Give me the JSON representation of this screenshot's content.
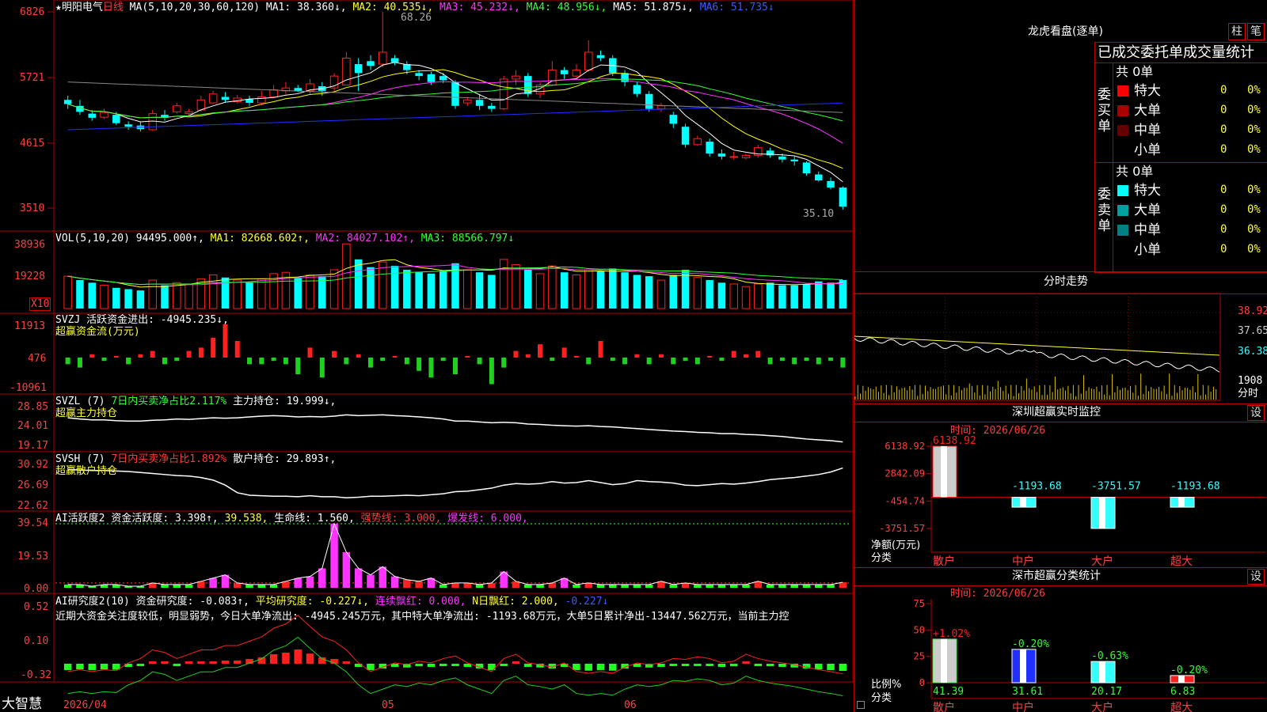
{
  "app": {
    "brand": "大智慧",
    "stock_name": "★明阳电气",
    "period": "日线"
  },
  "colors": {
    "up": "#ff2020",
    "down": "#00ffff",
    "grid": "#b00000",
    "ma1": "#ffffff",
    "ma2": "#ffff00",
    "ma3": "#ff33ff",
    "ma4": "#33ff33",
    "ma5": "#888888",
    "ma6": "#2030ff"
  },
  "price_panel": {
    "ma_header": "MA(5,10,20,30,60,120)",
    "ma1": "MA1: 38.360↓,",
    "ma2": "MA2: 40.535↓,",
    "ma3": "MA3: 45.232↓,",
    "ma4": "MA4: 48.956↓,",
    "ma5": "MA5: 51.875↓,",
    "ma6": "MA6: 51.735↓",
    "y_ticks": [
      "6826",
      "5721",
      "4615",
      "3510"
    ],
    "high_label": "68.26",
    "low_label": "35.10"
  },
  "volume_panel": {
    "header": "VOL(5,10,20)",
    "value": "94495.000↑,",
    "ma1": "MA1: 82668.602↑,",
    "ma2": "MA2: 84027.102↑,",
    "ma3": "MA3: 88566.797↓",
    "y_ticks": [
      "38936",
      "19228"
    ],
    "unit": "X10"
  },
  "svzj_panel": {
    "name": "SVZJ",
    "label": "活跃资金进出: -4945.235↓,",
    "sub": "超赢资金流(万元)",
    "y_ticks": [
      "11913",
      "476",
      "-10961"
    ]
  },
  "svzl_panel": {
    "name": "SVZL (7)",
    "label1": "7日内买卖净占比2.117%",
    "label2": "主力持仓: 19.999↓,",
    "sub": "超赢主力持仓",
    "y_ticks": [
      "28.85",
      "24.01",
      "19.17"
    ]
  },
  "svsh_panel": {
    "name": "SVSH (7)",
    "label1": "7日内买卖净占比1.892%",
    "label2": "散户持仓: 29.893↑,",
    "sub": "超赢散户持仓",
    "y_ticks": [
      "30.92",
      "26.69",
      "22.62"
    ]
  },
  "ai_active_panel": {
    "name": "AI活跃度2",
    "label1": "资金活跃度: 3.398↑,",
    "label2": "39.538,",
    "label3": "生命线: 1.560,",
    "label4": "强势线: 3.000,",
    "label5": "爆发线: 6.000,",
    "y_ticks": [
      "39.54",
      "19.53",
      "0.00"
    ]
  },
  "ai_research_panel": {
    "name": "AI研究度2(10)",
    "label1": "资金研究度: -0.083↑,",
    "label2": "平均研究度: -0.227↓,",
    "label3": "连续飘红: 0.000,",
    "label4": "N日飘红: 2.000,",
    "label5": "-0.227↓",
    "comment": "近期大资金关注度较低，明显弱势，今日大单净流出: -4945.245万元，其中特大单净流出: -1193.68万元，大单5日累计净出-13447.562万元，当前主力控",
    "y_ticks": [
      "0.52",
      "0.10",
      "-0.32"
    ]
  },
  "date_axis": [
    "2026/04",
    "05",
    "06"
  ],
  "right_panel": {
    "dragon_title": "龙虎看盘(逐单)",
    "tab_bar": "柱",
    "tab_pen": "笔",
    "stats_title": "已成交委托单成交量统计",
    "buy_side": {
      "label": "委买单",
      "total": "共 0单",
      "rows": [
        {
          "name": "特大",
          "count": "0",
          "pct": "0%",
          "color": "#ff0000"
        },
        {
          "name": "大单",
          "count": "0",
          "pct": "0%",
          "color": "#aa0000"
        },
        {
          "name": "中单",
          "count": "0",
          "pct": "0%",
          "color": "#660000"
        },
        {
          "name": "小单",
          "count": "0",
          "pct": "0%",
          "color": ""
        }
      ]
    },
    "sell_side": {
      "label": "委卖单",
      "total": "共 0单",
      "rows": [
        {
          "name": "特大",
          "count": "0",
          "pct": "0%",
          "color": "#00ffff"
        },
        {
          "name": "大单",
          "count": "0",
          "pct": "0%",
          "color": "#00a0a0"
        },
        {
          "name": "中单",
          "count": "0",
          "pct": "0%",
          "color": "#008080"
        },
        {
          "name": "小单",
          "count": "0",
          "pct": "0%",
          "color": ""
        }
      ]
    },
    "intraday": {
      "title": "分时走势",
      "y_ticks": [
        "38.92",
        "37.65",
        "36.38"
      ],
      "vol_label": "1908",
      "unit": "分时"
    },
    "monitor": {
      "title": "深圳超赢实时监控",
      "set": "设",
      "time": "时间: 2026/06/26",
      "y_ticks": [
        "6138.92",
        "2842.09",
        "-454.74",
        "-3751.57"
      ],
      "ylabel": "净额(万元)",
      "xlabel": "分类",
      "categories": [
        "散户",
        "中户",
        "大户",
        "超大"
      ],
      "values": [
        6138.92,
        -1193.68,
        -3751.57,
        -1193.68
      ],
      "value_labels": [
        "6138.92",
        "-1193.68",
        "-3751.57",
        "-1193.68"
      ]
    },
    "classify": {
      "title": "深市超赢分类统计",
      "set": "设",
      "time": "时间: 2026/06/26",
      "y_ticks": [
        "75",
        "50",
        "25",
        "0"
      ],
      "ylabel": "比例%",
      "xlabel": "分类",
      "categories": [
        "散户",
        "中户",
        "大户",
        "超大"
      ],
      "values": [
        41.39,
        31.61,
        20.17,
        6.83
      ],
      "value_labels": [
        "41.39",
        "31.61",
        "20.17",
        "6.83"
      ],
      "changes": [
        "+1.02%",
        "-0.20%",
        "-0.63%",
        "-0.20%"
      ]
    }
  },
  "chart_data": {
    "type": "candlestick",
    "title": "★明阳电气 日线",
    "ylim": [
      35.1,
      68.26
    ],
    "candles": [
      [
        53.5,
        52.8,
        54.2,
        52.0
      ],
      [
        52.5,
        51.5,
        53.5,
        51.0
      ],
      [
        51.2,
        50.5,
        51.8,
        50.0
      ],
      [
        50.6,
        51.4,
        52.0,
        50.3
      ],
      [
        51.0,
        49.6,
        51.5,
        49.3
      ],
      [
        49.4,
        49.0,
        49.9,
        48.5
      ],
      [
        49.2,
        48.6,
        49.8,
        48.2
      ],
      [
        48.5,
        51.2,
        51.8,
        48.3
      ],
      [
        51.0,
        50.5,
        51.8,
        50.0
      ],
      [
        51.5,
        52.5,
        53.0,
        51.2
      ],
      [
        51.2,
        51.5,
        52.0,
        50.8
      ],
      [
        51.8,
        53.5,
        54.2,
        51.5
      ],
      [
        53.0,
        54.5,
        55.0,
        52.8
      ],
      [
        54.0,
        53.5,
        54.8,
        53.0
      ],
      [
        53.2,
        53.8,
        54.3,
        52.9
      ],
      [
        53.6,
        53.0,
        54.2,
        52.5
      ],
      [
        53.0,
        54.0,
        55.0,
        52.6
      ],
      [
        54.0,
        55.2,
        56.0,
        53.8
      ],
      [
        55.0,
        55.5,
        56.5,
        54.5
      ],
      [
        55.5,
        55.0,
        56.0,
        54.8
      ],
      [
        55.0,
        56.2,
        57.0,
        54.5
      ],
      [
        55.8,
        55.0,
        56.5,
        54.2
      ],
      [
        55.5,
        57.5,
        58.0,
        55.0
      ],
      [
        56.0,
        60.5,
        61.5,
        56.0
      ],
      [
        59.5,
        58.0,
        60.5,
        55.0
      ],
      [
        60.0,
        59.2,
        61.0,
        58.5
      ],
      [
        59.5,
        61.5,
        68.26,
        59.0
      ],
      [
        60.5,
        59.8,
        61.0,
        59.3
      ],
      [
        59.5,
        58.5,
        60.0,
        57.8
      ],
      [
        58.0,
        57.5,
        58.5,
        56.8
      ],
      [
        57.8,
        56.5,
        58.2,
        56.0
      ],
      [
        57.5,
        56.8,
        58.0,
        56.3
      ],
      [
        56.5,
        52.5,
        56.8,
        52.0
      ],
      [
        53.0,
        53.5,
        54.0,
        52.5
      ],
      [
        53.5,
        52.5,
        54.5,
        51.8
      ],
      [
        52.5,
        52.0,
        53.0,
        51.5
      ],
      [
        52.0,
        57.0,
        57.5,
        51.8
      ],
      [
        57.0,
        57.5,
        58.5,
        56.0
      ],
      [
        57.5,
        54.5,
        58.0,
        54.0
      ],
      [
        54.5,
        56.0,
        56.5,
        53.8
      ],
      [
        56.0,
        58.5,
        60.0,
        55.8
      ],
      [
        58.5,
        57.8,
        59.0,
        57.0
      ],
      [
        57.5,
        58.5,
        59.5,
        57.2
      ],
      [
        58.5,
        61.5,
        63.5,
        58.2
      ],
      [
        61.0,
        60.5,
        61.8,
        60.0
      ],
      [
        60.5,
        58.0,
        61.0,
        57.5
      ],
      [
        58.0,
        56.5,
        58.5,
        55.8
      ],
      [
        56.0,
        54.5,
        56.5,
        54.0
      ],
      [
        54.5,
        52.0,
        55.0,
        51.5
      ],
      [
        52.0,
        52.5,
        53.0,
        51.5
      ],
      [
        51.0,
        49.5,
        51.5,
        48.8
      ],
      [
        49.0,
        46.0,
        49.5,
        45.5
      ],
      [
        46.0,
        47.0,
        47.5,
        45.8
      ],
      [
        46.5,
        44.5,
        47.0,
        44.0
      ],
      [
        44.5,
        44.0,
        45.2,
        43.5
      ],
      [
        44.0,
        44.0,
        44.8,
        43.5
      ],
      [
        43.8,
        44.2,
        44.5,
        43.5
      ],
      [
        44.2,
        45.5,
        46.0,
        43.8
      ],
      [
        45.0,
        44.2,
        45.5,
        43.8
      ],
      [
        44.0,
        43.5,
        44.5,
        43.0
      ],
      [
        43.5,
        43.2,
        44.0,
        42.5
      ],
      [
        43.0,
        41.2,
        43.2,
        40.8
      ],
      [
        41.0,
        40.0,
        41.5,
        39.8
      ],
      [
        39.9,
        38.8,
        40.5,
        38.5
      ],
      [
        38.8,
        35.6,
        39.0,
        35.1
      ]
    ],
    "volume": [
      25,
      22,
      20,
      18,
      16,
      15,
      14,
      22,
      18,
      20,
      19,
      23,
      26,
      24,
      22,
      20,
      23,
      27,
      28,
      24,
      26,
      25,
      30,
      50,
      38,
      32,
      36,
      33,
      30,
      28,
      27,
      29,
      35,
      30,
      28,
      26,
      38,
      34,
      30,
      27,
      33,
      28,
      26,
      30,
      29,
      31,
      28,
      26,
      25,
      22,
      26,
      30,
      24,
      22,
      20,
      19,
      17,
      19,
      20,
      18,
      18,
      19,
      21,
      20,
      22
    ],
    "volume_up": [
      1,
      0,
      0,
      1,
      0,
      0,
      0,
      1,
      0,
      1,
      1,
      1,
      1,
      0,
      1,
      0,
      1,
      1,
      1,
      0,
      1,
      0,
      1,
      1,
      0,
      0,
      1,
      0,
      0,
      0,
      0,
      0,
      0,
      1,
      0,
      0,
      1,
      1,
      0,
      1,
      1,
      0,
      1,
      1,
      0,
      0,
      0,
      0,
      0,
      1,
      0,
      0,
      1,
      0,
      0,
      1,
      1,
      1,
      0,
      0,
      0,
      0,
      0,
      0,
      0
    ],
    "fund_flow": [
      -2,
      -3,
      1,
      -1,
      0,
      -2,
      1,
      2,
      -2,
      -1,
      2,
      3,
      6,
      10,
      5,
      -2,
      -2,
      -1,
      -2,
      -5,
      3,
      -6,
      2,
      -2,
      1,
      -3,
      -1,
      0,
      -2,
      -4,
      -6,
      -1,
      -5,
      0,
      -2,
      -8,
      -3,
      2,
      1,
      4,
      -1,
      3,
      0,
      -2,
      5,
      -1,
      -2,
      1,
      -2,
      1,
      -2,
      -1,
      -2,
      0,
      -1,
      2,
      1,
      2,
      -2,
      -1,
      -2,
      -1,
      -2,
      -1,
      -3
    ],
    "main_position": [
      25.8,
      25.5,
      25.3,
      25.3,
      25.1,
      25.0,
      25.0,
      25.2,
      25.3,
      25.5,
      25.4,
      25.6,
      25.8,
      25.7,
      25.8,
      26.0,
      26.2,
      26.3,
      26.2,
      26.0,
      26.1,
      26.0,
      26.2,
      26.5,
      26.3,
      26.4,
      26.5,
      26.3,
      26.2,
      26.0,
      25.8,
      25.5,
      25.0,
      25.0,
      24.8,
      24.6,
      24.7,
      24.6,
      24.3,
      24.2,
      24.0,
      23.9,
      23.8,
      23.9,
      23.7,
      23.6,
      23.4,
      23.2,
      23.0,
      22.8,
      22.6,
      22.5,
      22.3,
      22.2,
      22.0,
      22.0,
      21.8,
      21.7,
      21.5,
      21.3,
      21.0,
      20.7,
      20.5,
      20.3,
      19.999
    ],
    "retail_position": [
      29.6,
      29.5,
      29.4,
      29.4,
      29.3,
      29.2,
      29.0,
      28.8,
      28.6,
      28.4,
      28.3,
      28.0,
      27.5,
      26.5,
      25.0,
      24.5,
      24.4,
      24.3,
      24.3,
      24.2,
      24.4,
      24.2,
      24.2,
      24.0,
      24.1,
      24.3,
      24.3,
      24.4,
      24.5,
      24.4,
      24.6,
      24.8,
      25.2,
      25.3,
      25.6,
      25.9,
      26.5,
      26.8,
      26.7,
      26.8,
      27.2,
      26.9,
      27.0,
      27.4,
      27.0,
      26.6,
      26.8,
      27.4,
      27.2,
      27.1,
      26.9,
      26.5,
      26.4,
      26.6,
      26.8,
      26.7,
      26.9,
      27.2,
      27.6,
      27.8,
      28.0,
      28.3,
      28.6,
      29.1,
      29.893
    ],
    "ai_active": [
      2,
      2,
      1,
      2,
      2,
      1,
      1,
      3,
      2,
      2,
      2,
      4,
      6,
      8,
      3,
      2,
      2,
      2,
      4,
      6,
      7,
      12,
      39.5,
      22,
      12,
      8,
      13,
      7,
      5,
      4,
      6,
      2,
      3,
      3,
      2,
      3,
      10,
      4,
      2,
      2,
      3,
      6,
      2,
      3,
      2,
      2,
      2,
      2,
      2,
      4,
      2,
      3,
      2,
      2,
      2,
      2,
      2,
      4,
      2,
      2,
      2,
      2,
      2,
      2,
      3.4
    ],
    "ai_research": [
      -0.2,
      -0.18,
      -0.2,
      -0.18,
      -0.19,
      -0.1,
      -0.05,
      0.05,
      0.02,
      -0.05,
      0.0,
      0.05,
      0.05,
      0.1,
      0.1,
      0.15,
      0.2,
      0.3,
      0.35,
      0.45,
      0.32,
      0.2,
      0.15,
      0.05,
      -0.1,
      -0.2,
      -0.15,
      -0.1,
      -0.12,
      -0.08,
      -0.1,
      -0.05,
      -0.02,
      -0.1,
      -0.15,
      -0.2,
      -0.05,
      0.0,
      -0.1,
      -0.12,
      -0.15,
      -0.1,
      -0.2,
      -0.22,
      -0.2,
      -0.22,
      -0.15,
      -0.1,
      -0.12,
      -0.1,
      -0.05,
      -0.06,
      -0.03,
      -0.05,
      -0.1,
      -0.08,
      0.0,
      -0.05,
      -0.08,
      -0.1,
      -0.12,
      -0.15,
      -0.18,
      -0.2,
      -0.227
    ]
  }
}
